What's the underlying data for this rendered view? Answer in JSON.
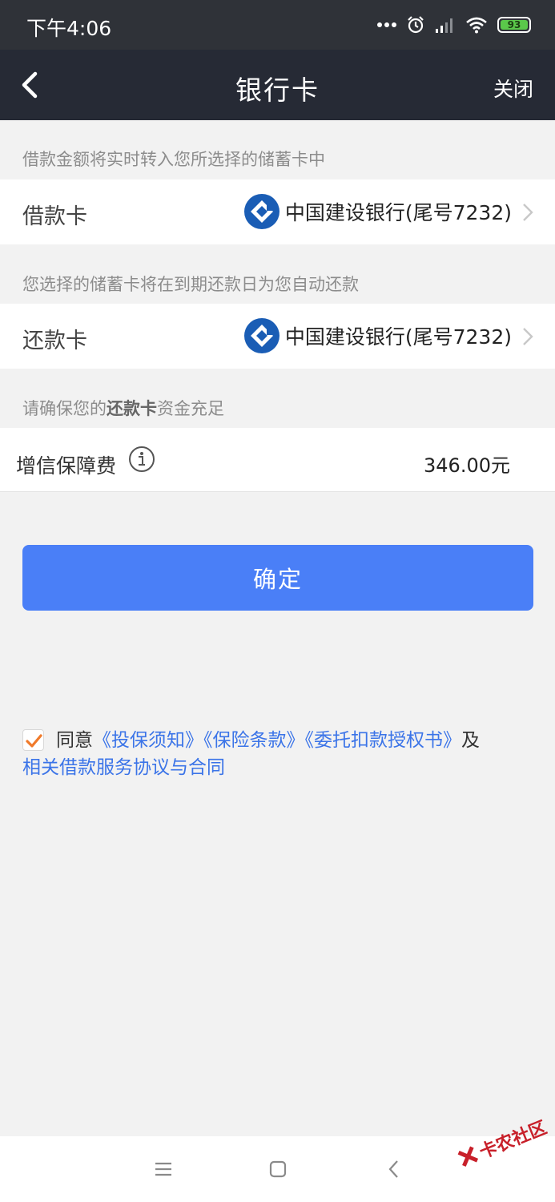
{
  "status_bar": {
    "time": "下午4:06",
    "battery": "93",
    "icons": [
      "more-dots-icon",
      "alarm-icon",
      "signal-icon",
      "wifi-icon",
      "battery-icon"
    ]
  },
  "nav": {
    "title": "银行卡",
    "close_label": "关闭"
  },
  "loan_section": {
    "hint": "借款金额将实时转入您所选择的储蓄卡中",
    "label": "借款卡",
    "bank": "中国建设银行(尾号7232)"
  },
  "repay_section": {
    "hint": "您选择的储蓄卡将在到期还款日为您自动还款",
    "label": "还款卡",
    "bank": "中国建设银行(尾号7232)"
  },
  "ensure_hint": {
    "prefix": "请确保您的",
    "bold": "还款卡",
    "suffix": "资金充足"
  },
  "fee": {
    "label": "增信保障费",
    "amount": "346.00元"
  },
  "confirm_label": "确定",
  "agreement": {
    "checked": true,
    "prefix": "同意",
    "link1": "《投保须知》",
    "link2": "《保险条款》",
    "link3": "《委托扣款授权书》",
    "suffix": "及",
    "link4": "相关借款服务协议与合同"
  },
  "watermark": "卡农社区",
  "colors": {
    "status_bar": "#2f3238",
    "nav_bar": "#262a35",
    "primary_button": "#4a7ff7",
    "link": "#3b74e8",
    "checkbox_check": "#f07a2a",
    "bank_logo": "#1a5db5"
  }
}
